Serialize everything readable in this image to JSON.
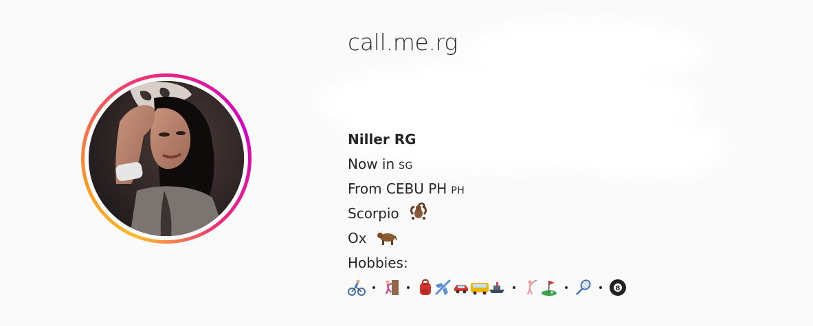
{
  "profile": {
    "username": "call.me.rg",
    "avatar_alt": "profile-photo"
  },
  "bio": {
    "name": "Niller RG",
    "now_in": "Now in",
    "now_in_code": "SG",
    "from": "From CEBU PH",
    "from_code": "PH",
    "zodiac": "Scorpio",
    "zodiac_icon": "scorpion-icon",
    "year": "Ox",
    "year_icon": "ox-icon",
    "hobbies_label": "Hobbies:",
    "hobbies": [
      {
        "icon": "cycling-icon"
      },
      {
        "icon": "climbing-icon"
      },
      {
        "icon": "backpack-icon"
      },
      {
        "icon": "airplane-icon"
      },
      {
        "icon": "car-icon"
      },
      {
        "icon": "bus-icon"
      },
      {
        "icon": "ship-icon"
      },
      {
        "icon": "golfer-icon"
      },
      {
        "icon": "golf-flag-icon"
      },
      {
        "icon": "badminton-icon"
      },
      {
        "icon": "billiard-8-ball-icon"
      }
    ]
  },
  "colors": {
    "ring_start": "#fdbb2d",
    "ring_mid": "#ee2a7b",
    "ring_end": "#d300c5",
    "text": "#262626",
    "background": "#fafafa"
  }
}
